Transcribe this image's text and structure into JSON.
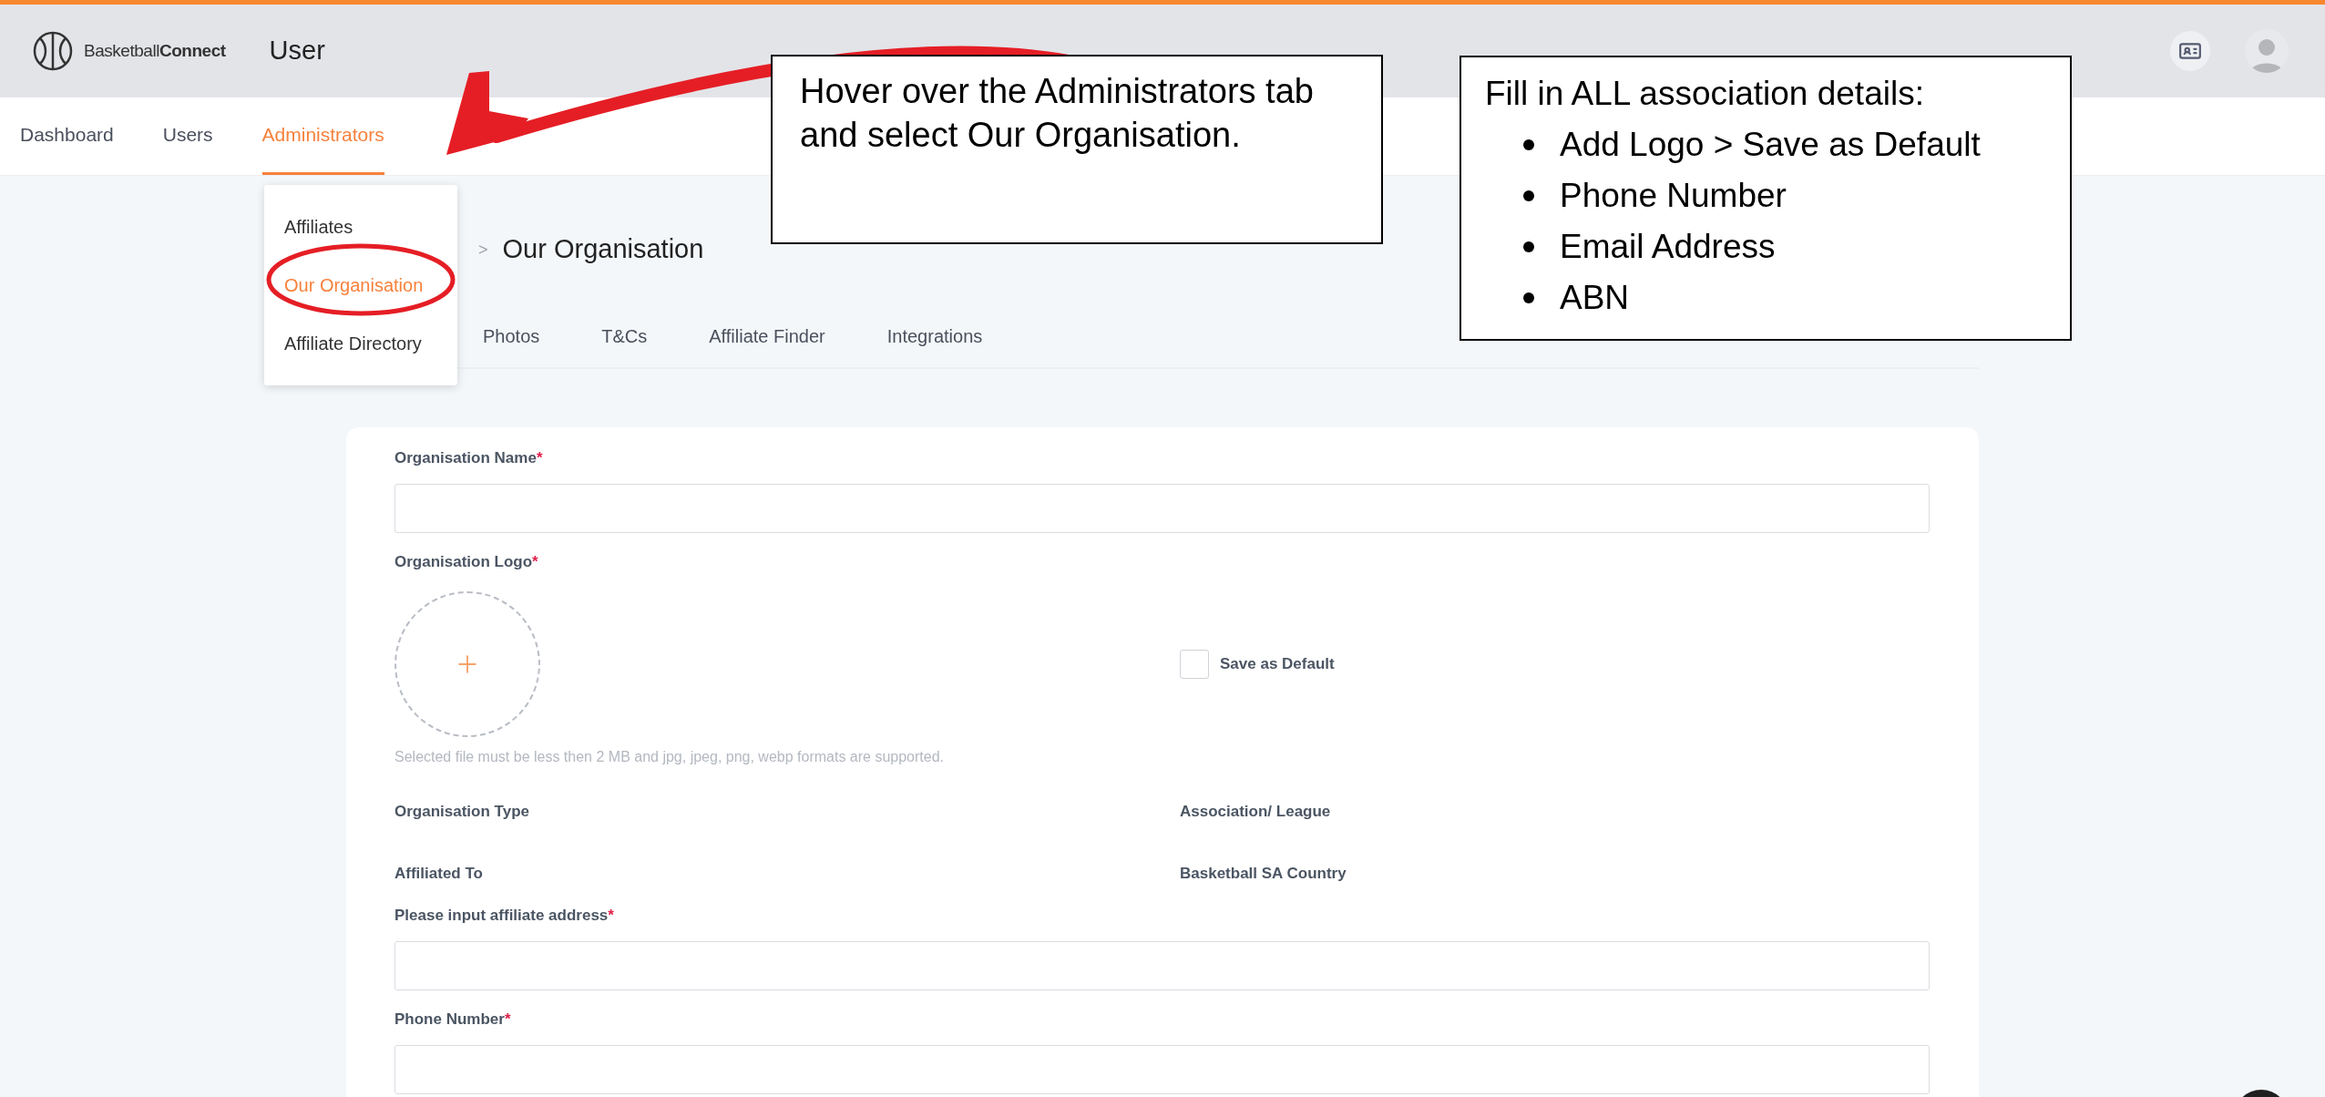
{
  "header": {
    "logo": "Basketball**Connect**",
    "title": "User"
  },
  "nav_tabs": [
    {
      "label": "Dashboard",
      "selected": false
    },
    {
      "label": "Users",
      "selected": false
    },
    {
      "label": "Administrators",
      "selected": true
    }
  ],
  "dropdown": [
    {
      "label": "Affiliates",
      "selected": false
    },
    {
      "label": "Our Organisation",
      "selected": true
    },
    {
      "label": "Affiliate Directory",
      "selected": false
    }
  ],
  "breadcrumb": {
    "separator": ">",
    "current": "Our Organisation"
  },
  "sub_tabs": [
    {
      "label": "Photos"
    },
    {
      "label": "T&Cs"
    },
    {
      "label": "Affiliate Finder"
    },
    {
      "label": "Integrations"
    }
  ],
  "form": [
    {
      "kind": "input",
      "label": "Organisation Name",
      "required_mark": "*"
    },
    {
      "kind": "logo",
      "label": "Organisation Logo",
      "required_mark": "*",
      "checkbox_label": "Save as Default",
      "checked": false,
      "hint": "Selected file must be less then 2 MB and jpg, jpeg, png, webp formats are supported."
    },
    {
      "kind": "info",
      "label": "Organisation Type",
      "value": "Association/ League"
    },
    {
      "kind": "info",
      "label": "Affiliated To",
      "value": "Basketball SA Country"
    },
    {
      "kind": "input",
      "label": "Please input affiliate address",
      "required_mark": "*"
    },
    {
      "kind": "input",
      "label": "Phone Number",
      "required_mark": "*"
    }
  ],
  "annotations": [
    {
      "kind": "text",
      "text": "Hover over the Administrators tab and select Our Organisation."
    },
    {
      "kind": "list",
      "text": "Fill in ALL association details:",
      "bullets": [
        "Add Logo > Save as Default",
        "Phone Number",
        "Email Address",
        "ABN"
      ]
    }
  ]
}
